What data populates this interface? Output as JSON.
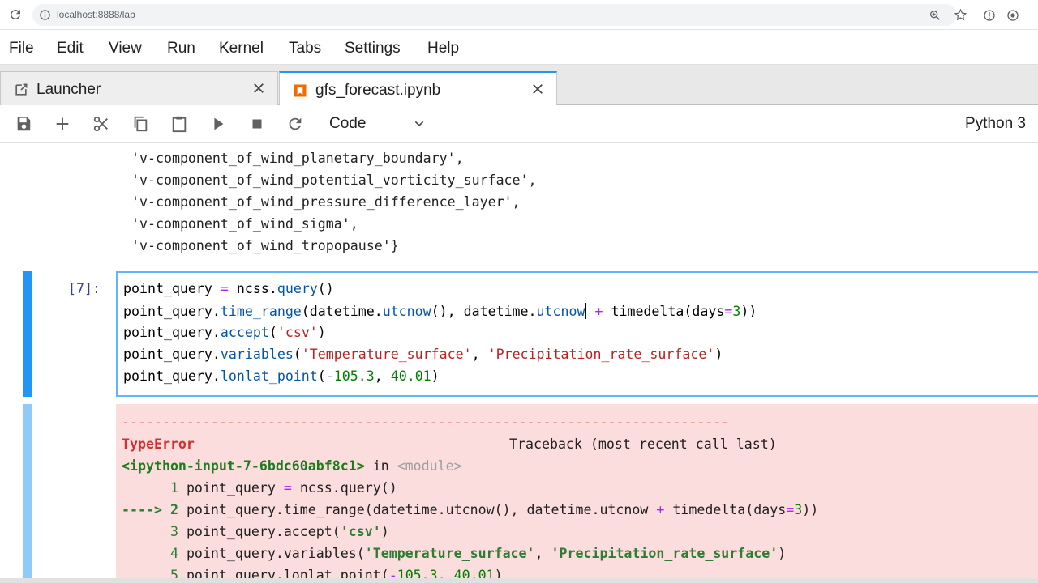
{
  "browser": {
    "url": "localhost:8888/lab"
  },
  "menu": [
    "File",
    "Edit",
    "View",
    "Run",
    "Kernel",
    "Tabs",
    "Settings",
    "Help"
  ],
  "tabs": [
    {
      "label": "Launcher"
    },
    {
      "label": "gfs_forecast.ipynb"
    }
  ],
  "toolbar": {
    "cell_type": "Code",
    "kernel": "Python 3"
  },
  "output_lines": [
    "'v-component_of_wind_planetary_boundary',",
    "'v-component_of_wind_potential_vorticity_surface',",
    "'v-component_of_wind_pressure_difference_layer',",
    "'v-component_of_wind_sigma',",
    "'v-component_of_wind_tropopause'}"
  ],
  "cell": {
    "prompt": "[7]:",
    "code": [
      "point_query = ncss.query()",
      "point_query.time_range(datetime.utcnow(), datetime.utcnow + timedelta(days=3))",
      "point_query.accept('csv')",
      "point_query.variables('Temperature_surface', 'Precipitation_rate_surface')",
      "point_query.lonlat_point(-105.3, 40.01)"
    ]
  },
  "error": {
    "dashes": "---------------------------------------------------------------------------",
    "type": "TypeError",
    "traceback_label": "Traceback (most recent call last)",
    "input_ref": "<ipython-input-7-6bdc60abf8c1>",
    "in_word": " in ",
    "module": "<module>",
    "lines": [
      {
        "marker": "      1 ",
        "code": "point_query = ncss.query()"
      },
      {
        "marker": "----> 2 ",
        "code": "point_query.time_range(datetime.utcnow(), datetime.utcnow + timedelta(days=3))"
      },
      {
        "marker": "      3 ",
        "code": "point_query.accept('csv')"
      },
      {
        "marker": "      4 ",
        "code": "point_query.variables('Temperature_surface', 'Precipitation_rate_surface')"
      },
      {
        "marker": "      5 ",
        "code": "point_query.lonlat_point(-105.3, 40.01)"
      }
    ]
  }
}
